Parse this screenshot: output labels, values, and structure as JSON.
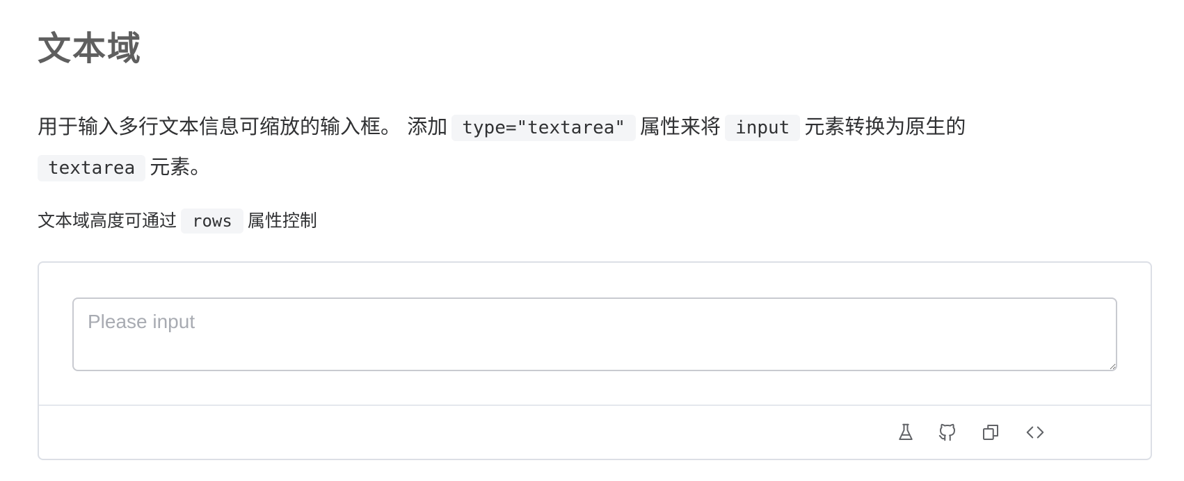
{
  "section": {
    "title": "文本域",
    "intro": {
      "part1": "用于输入多行文本信息可缩放的输入框。 添加",
      "code1": "type=\"textarea\"",
      "part2": "属性来将",
      "code2": "input",
      "part3": "元素转换为原生的",
      "code3": "textarea",
      "part4": "元素。"
    },
    "rows_note": {
      "part1": "文本域高度可通过",
      "code": "rows",
      "part2": "属性控制"
    }
  },
  "demo": {
    "textarea": {
      "value": "",
      "placeholder": "Please input"
    },
    "toolbar": {
      "icons": [
        "playground-flask-icon",
        "github-icon",
        "copy-icon",
        "view-source-icon"
      ]
    }
  }
}
